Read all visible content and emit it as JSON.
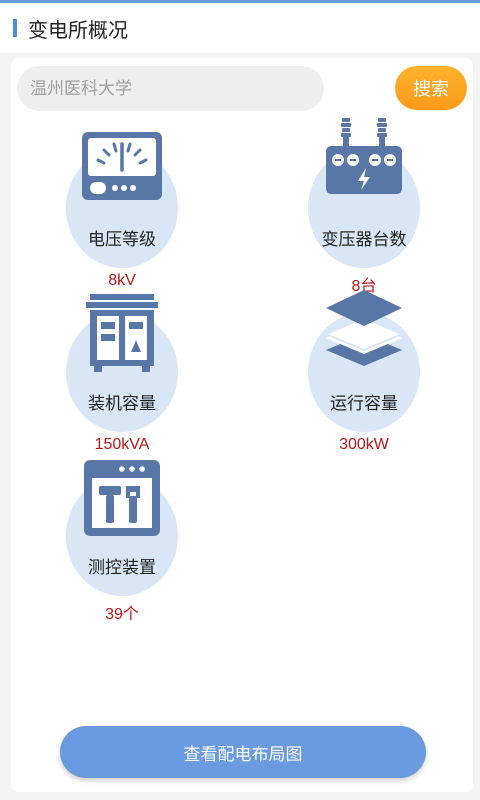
{
  "header": {
    "title": "变电所概况"
  },
  "search": {
    "placeholder": "温州医科大学",
    "button_label": "搜索"
  },
  "items": [
    {
      "label": "电压等级",
      "value": "8kV",
      "icon": "voltmeter-icon"
    },
    {
      "label": "变压器台数",
      "value": "8台",
      "icon": "transformer-icon"
    },
    {
      "label": "装机容量",
      "value": "150kVA",
      "icon": "cabinet-icon"
    },
    {
      "label": "运行容量",
      "value": "300kW",
      "icon": "layers-icon"
    },
    {
      "label": "测控装置",
      "value": "39个",
      "icon": "tools-window-icon"
    }
  ],
  "footer": {
    "map_button_label": "查看配电布局图"
  },
  "colors": {
    "accent": "#6a9ae0",
    "search_button": "#fb9a1a",
    "value_text": "#b51818",
    "icon": "#5877a6",
    "icon_bg": "#d8e6f6"
  }
}
